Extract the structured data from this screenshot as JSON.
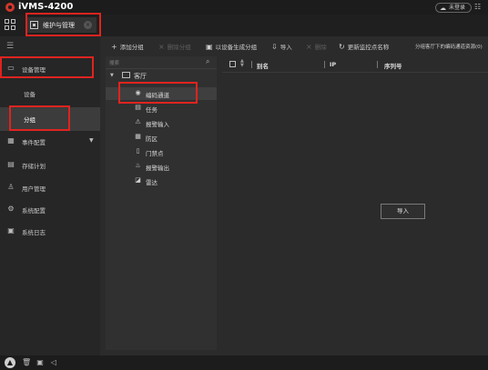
{
  "app": {
    "title": "iVMS-4200",
    "login_label": "未登录",
    "tab_label": "维护与管理"
  },
  "sidebar": {
    "items": [
      {
        "label": "设备管理",
        "icon": "device-management-icon"
      },
      {
        "label": "设备"
      },
      {
        "label": "分组"
      },
      {
        "label": "事件配置",
        "icon": "event-config-icon"
      },
      {
        "label": "存储计划",
        "icon": "storage-plan-icon"
      },
      {
        "label": "用户管理",
        "icon": "user-icon"
      },
      {
        "label": "系统配置",
        "icon": "gear-icon"
      },
      {
        "label": "系统日志",
        "icon": "log-icon"
      }
    ]
  },
  "toolbar": {
    "add_group": "添加分组",
    "delete_group": "删除分组",
    "create_by_device": "以设备生成分组",
    "import": "导入",
    "delete": "删除",
    "update_names": "更新监控点名称",
    "sync_names": "分组客厅下的编码通道资源(0)"
  },
  "tree": {
    "search_placeholder": "搜索",
    "root_label": "客厅",
    "items": [
      {
        "label": "编码通道",
        "selected": true
      },
      {
        "label": "任务"
      },
      {
        "label": "报警输入"
      },
      {
        "label": "防区"
      },
      {
        "label": "门禁点"
      },
      {
        "label": "报警输出"
      },
      {
        "label": "雷达"
      }
    ]
  },
  "table": {
    "columns": [
      "别名",
      "IP",
      "序列号"
    ],
    "import_button": "导入"
  },
  "colors": {
    "highlight": "#e0231f",
    "background": "#2b2b2b",
    "logo": "#d4362c"
  }
}
